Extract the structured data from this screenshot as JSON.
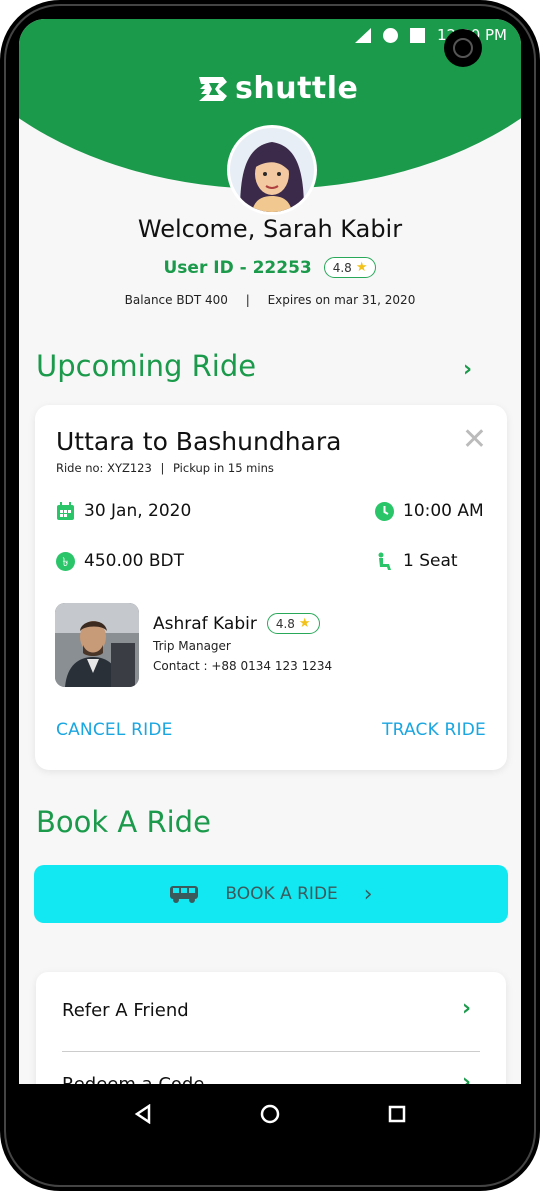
{
  "status_bar": {
    "time": "12:30 PM"
  },
  "app": {
    "logo_text": "shuttle"
  },
  "profile": {
    "welcome": "Welcome, Sarah Kabir",
    "user_id": "User ID - 22253",
    "rating": "4.8",
    "balance": "Balance BDT 400",
    "separator": "|",
    "expires": "Expires on mar 31, 2020"
  },
  "upcoming": {
    "title": "Upcoming Ride",
    "route": "Uttara to Bashundhara",
    "ride_no": "Ride no: XYZ123",
    "sub_separator": "|",
    "pickup": "Pickup in 15 mins",
    "date": "30 Jan, 2020",
    "time": "10:00 AM",
    "fare": "450.00 BDT",
    "seats": "1 Seat",
    "driver": {
      "name": "Ashraf Kabir",
      "rating": "4.8",
      "role": "Trip Manager",
      "contact": "Contact :  +88 0134 123 1234"
    },
    "cancel_label": "CANCEL RIDE",
    "track_label": "TRACK RIDE"
  },
  "book": {
    "title": "Book A Ride",
    "button_label": "BOOK A RIDE"
  },
  "menu": {
    "items": [
      {
        "label": "Refer A Friend"
      },
      {
        "label": "Redeem a Code"
      }
    ]
  },
  "colors": {
    "brand_green": "#1a9a4a",
    "accent_cyan": "#12e8f2",
    "link_blue": "#1aa6e0",
    "icon_green": "#2ac569"
  },
  "icons": [
    "signal-icon",
    "wifi-icon",
    "battery-icon",
    "calendar-icon",
    "clock-icon",
    "currency-icon",
    "seat-icon",
    "close-icon",
    "star-icon",
    "bus-icon",
    "chevron-right-icon",
    "back-icon",
    "home-icon",
    "recents-icon"
  ]
}
